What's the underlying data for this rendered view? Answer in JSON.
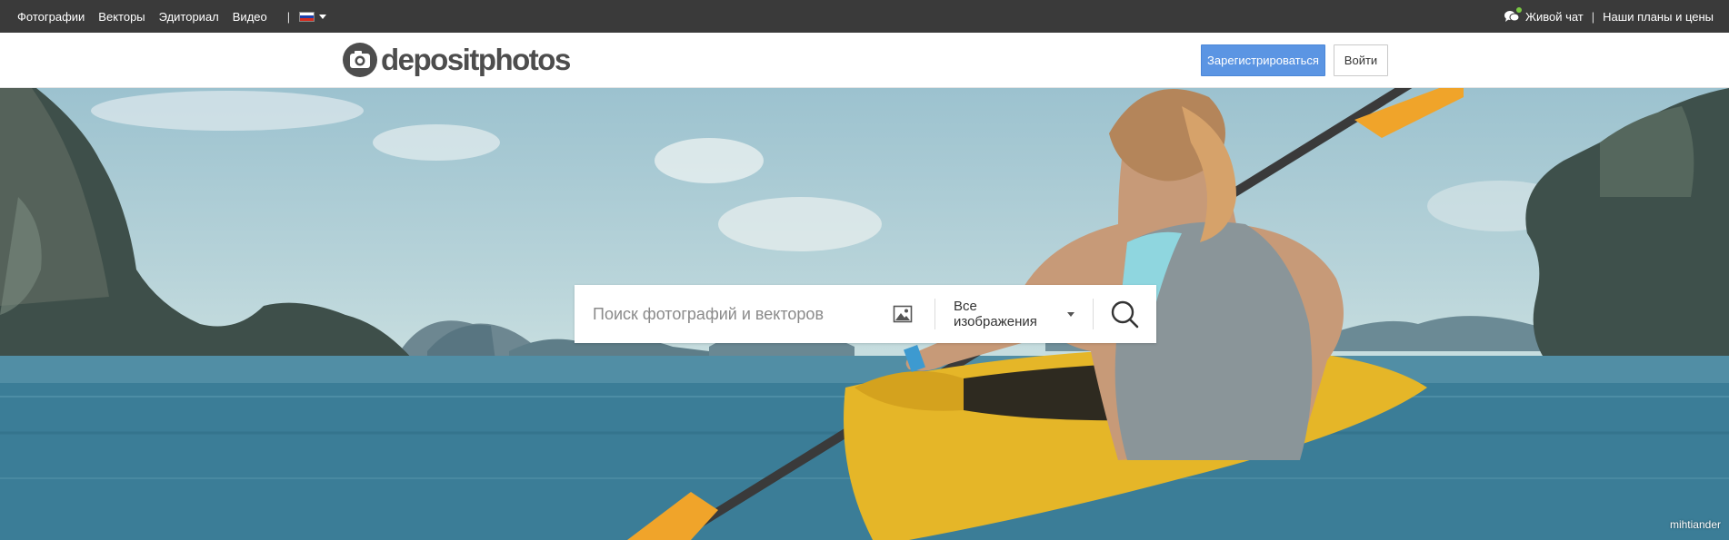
{
  "topbar": {
    "nav": [
      "Фотографии",
      "Векторы",
      "Эдиториал",
      "Видео"
    ],
    "separator": "|",
    "lang_flag": "flag-ru-icon",
    "live_chat": "Живой чат",
    "right_separator": "|",
    "plans": "Наши планы и цены",
    "background": "#3a3a3a"
  },
  "header": {
    "logo_text": "depositphotos",
    "register_label": "Зарегистрироваться",
    "login_label": "Войти",
    "accent": "#5b95e3"
  },
  "search": {
    "placeholder": "Поиск фотографий и векторов",
    "value": "",
    "type_selected": "Все изображения",
    "image_search_icon": "image-search-icon",
    "submit_icon": "search-icon"
  },
  "hero": {
    "credit": "mihtiander"
  }
}
